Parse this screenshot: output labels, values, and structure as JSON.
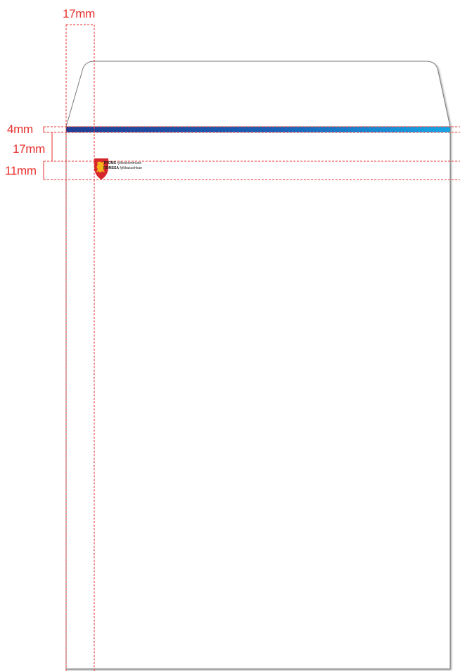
{
  "dimensions": {
    "left_margin": "17mm",
    "stripe_height": "4mm",
    "stripe_to_logo": "17mm",
    "logo_height": "11mm"
  },
  "brand": {
    "line1_bold": "TROMS",
    "line1_rest": " fylkeskommune",
    "line2_bold": "ROMSSA",
    "line2_rest": " fylkkasuohkan"
  },
  "colors": {
    "guide_red": "#e8312f",
    "stripe_start": "#1f3f96",
    "stripe_end": "#17a6e6",
    "envelope_border": "#7a7a7a",
    "crest_red": "#d7262b",
    "crest_gold": "#f3b51b"
  },
  "icons": {
    "crest": "griffin-shield-icon"
  }
}
